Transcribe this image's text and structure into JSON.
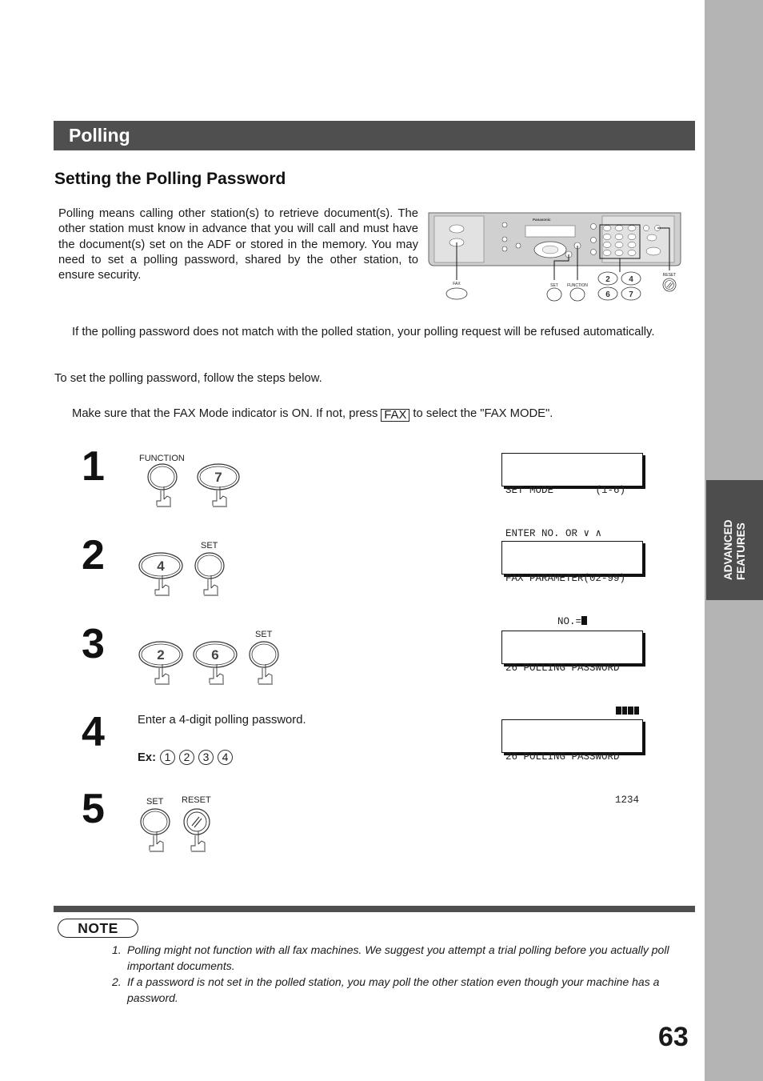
{
  "side_tab": {
    "line1": "ADVANCED",
    "line2": "FEATURES"
  },
  "section": {
    "title": "Polling"
  },
  "subtitle": "Setting the Polling Password",
  "intro": "Polling means calling other station(s) to retrieve document(s). The other station must know in advance that you will call and must have the document(s) set on the ADF or stored in the memory.  You may need to set a polling password, shared by the other station, to ensure security.",
  "paragraph2": "If the polling password does not match with the polled station, your polling request will be refused automatically.",
  "paragraph3": "To set the polling password, follow the steps below.",
  "paragraph4": {
    "before": "Make sure that the FAX Mode indicator is ON.  If not, press",
    "key": "FAX",
    "after": "to select the \"FAX MODE\"."
  },
  "panel": {
    "brand": "Panasonic",
    "labels": {
      "fax": "FAX",
      "set": "SET",
      "function": "FUNCTION",
      "reset": "RESET"
    },
    "digits": [
      "2",
      "4",
      "6",
      "7"
    ]
  },
  "steps": [
    {
      "number": "1",
      "buttons": [
        {
          "label": "FUNCTION",
          "key": ""
        },
        {
          "label": "",
          "key": "7"
        }
      ],
      "lcd": [
        "SET MODE       (1-6)",
        "ENTER NO. OR ∨ ∧"
      ]
    },
    {
      "number": "2",
      "buttons": [
        {
          "label": "",
          "key": "4"
        },
        {
          "label": "SET",
          "key": ""
        }
      ],
      "lcd": [
        "FAX PARAMETER(02-99)",
        "NO.="
      ]
    },
    {
      "number": "3",
      "buttons": [
        {
          "label": "",
          "key": "2"
        },
        {
          "label": "",
          "key": "6"
        },
        {
          "label": "SET",
          "key": ""
        }
      ],
      "lcd": [
        "26 POLLING PASSWORD",
        ""
      ]
    },
    {
      "number": "4",
      "instruction": "Enter a 4-digit polling password.",
      "example_label": "Ex:",
      "example_digits": [
        "1",
        "2",
        "3",
        "4"
      ],
      "lcd": [
        "26 POLLING PASSWORD",
        "1234"
      ]
    },
    {
      "number": "5",
      "buttons": [
        {
          "label": "SET",
          "key": ""
        },
        {
          "label": "RESET",
          "key": ""
        }
      ]
    }
  ],
  "note": {
    "badge": "NOTE",
    "items": [
      {
        "num": "1.",
        "text": "Polling might not function with all fax machines.  We suggest you attempt a trial polling before you actually poll important documents."
      },
      {
        "num": "2.",
        "text": "If a password is not set in the polled station, you may poll the other station even though your machine has a password."
      }
    ]
  },
  "page_number": "63"
}
